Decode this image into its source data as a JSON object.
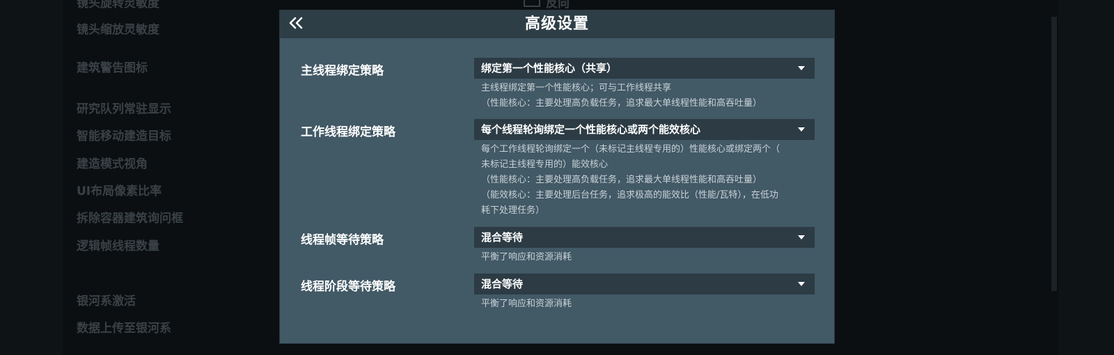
{
  "background": {
    "top_left_text": "镜头旋转灵敏度",
    "top_right_text": "反向",
    "items": [
      "镜头缩放灵敏度",
      "建筑警告图标",
      "研究队列常驻显示",
      "智能移动建造目标",
      "建造模式视角",
      "UI布局像素比率",
      "拆除容器建筑询问框",
      "逻辑帧线程数量",
      "银河系激活",
      "数据上传至银河系"
    ]
  },
  "dialog": {
    "title": "高级设置",
    "back_icon": "double-chevron-left-icon",
    "rows": [
      {
        "label": "主线程绑定策略",
        "value": "绑定第一个性能核心（共享）",
        "description": [
          "主线程绑定第一个性能核心；可与工作线程共享",
          "（性能核心：主要处理高负载任务，追求最大单线程性能和高吞吐量）"
        ]
      },
      {
        "label": "工作线程绑定策略",
        "value": "每个线程轮询绑定一个性能核心或两个能效核心",
        "description": [
          "每个工作线程轮询绑定一个（未标记主线程专用的）性能核心或绑定两个（",
          "未标记主线程专用的）能效核心",
          "（性能核心：主要处理高负载任务，追求最大单线程性能和高吞吐量）",
          "（能效核心：主要处理后台任务，追求极高的能效比（性能/瓦特），在低功",
          "耗下处理任务）"
        ]
      },
      {
        "label": "线程帧等待策略",
        "value": "混合等待",
        "description": [
          "平衡了响应和资源消耗"
        ]
      },
      {
        "label": "线程阶段等待策略",
        "value": "混合等待",
        "description": [
          "平衡了响应和资源消耗"
        ]
      }
    ]
  }
}
